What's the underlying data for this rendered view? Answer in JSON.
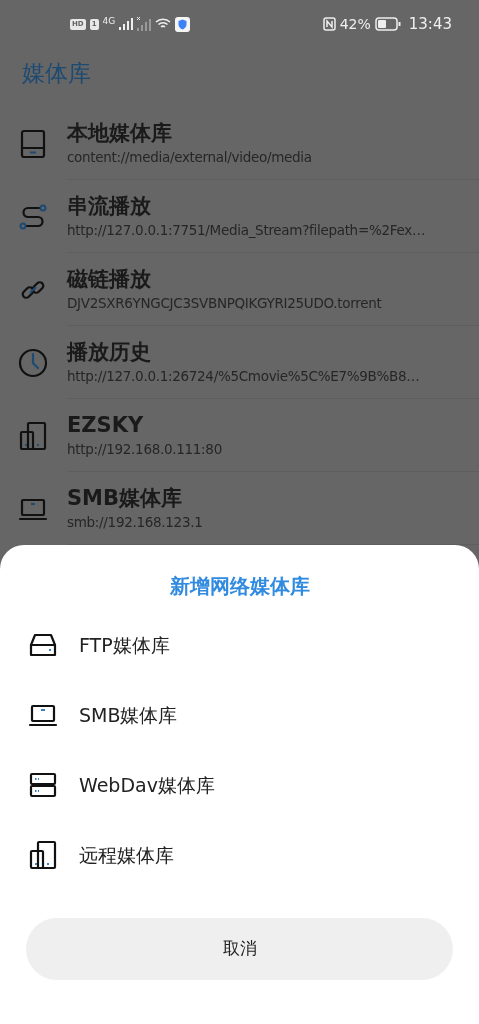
{
  "status_bar": {
    "hd": "HD",
    "sim": "1",
    "network": "4G",
    "battery": "42%",
    "time": "13:43"
  },
  "app_bar": {
    "title": "媒体库"
  },
  "libraries": [
    {
      "kind": "local",
      "title": "本地媒体库",
      "subtitle": "content://media/external/video/media"
    },
    {
      "kind": "stream",
      "title": "串流播放",
      "subtitle": "http://127.0.0.1:7751/Media_Stream?filepath=%2Fex…"
    },
    {
      "kind": "magnet",
      "title": "磁链播放",
      "subtitle": "DJV2SXR6YNGCJC3SVBNPQIKGYRI25UDO.torrent"
    },
    {
      "kind": "history",
      "title": "播放历史",
      "subtitle": "http://127.0.0.1:26724/%5Cmovie%5C%E7%9B%B8…"
    },
    {
      "kind": "remote",
      "title": "EZSKY",
      "subtitle": "http://192.168.0.111:80"
    },
    {
      "kind": "smb",
      "title": "SMB媒体库",
      "subtitle": "smb://192.168.123.1"
    }
  ],
  "sheet": {
    "title": "新增网络媒体库",
    "options": [
      {
        "kind": "ftp",
        "label": "FTP媒体库"
      },
      {
        "kind": "smb",
        "label": "SMB媒体库"
      },
      {
        "kind": "webdav",
        "label": "WebDav媒体库"
      },
      {
        "kind": "remote",
        "label": "远程媒体库"
      }
    ],
    "cancel": "取消"
  }
}
